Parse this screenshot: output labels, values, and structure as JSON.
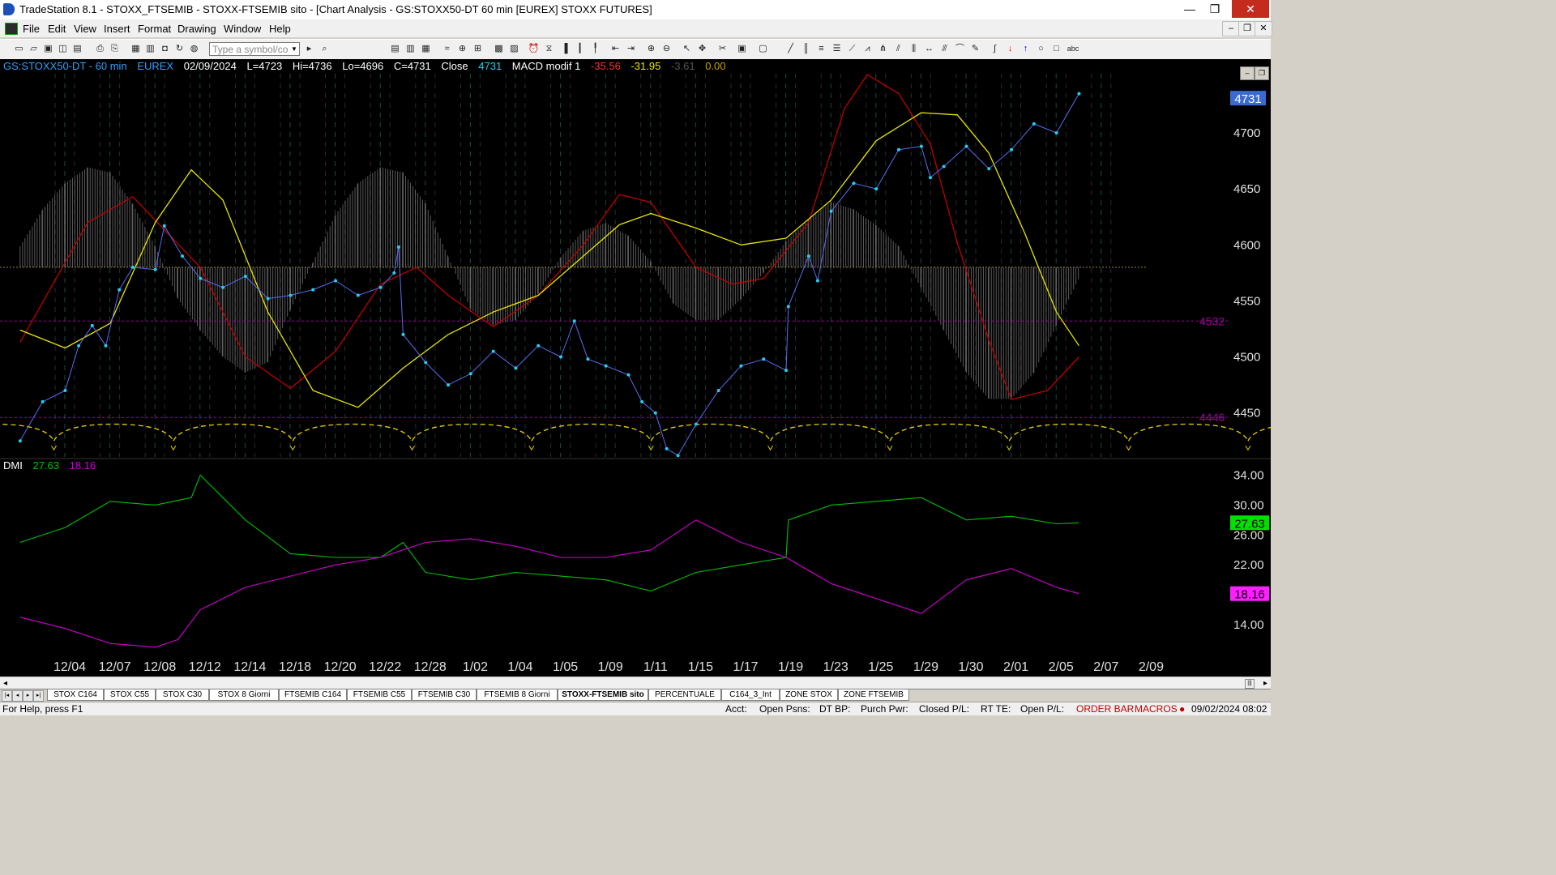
{
  "window": {
    "title": "TradeStation 8.1 - STOXX_FTSEMIB - STOXX-FTSEMIB sito - [Chart Analysis - GS:STOXX50-DT  60 min  [EUREX] STOXX FUTURES]",
    "minimize": "—",
    "maximize": "❐",
    "close": "✕"
  },
  "menu": {
    "items": [
      "File",
      "Edit",
      "View",
      "Insert",
      "Format",
      "Drawing",
      "Window",
      "Help"
    ],
    "mdi_min": "–",
    "mdi_restore": "❐",
    "mdi_close": "✕"
  },
  "toolbar": {
    "symbol_placeholder": "Type a symbol/co",
    "dropdown_icon": "▼"
  },
  "chart_header": {
    "symbol": "GS:STOXX50-DT - 60 min",
    "exchange": "EUREX",
    "date": "02/09/2024",
    "last": "L=4723",
    "high": "Hi=4736",
    "low": "Lo=4696",
    "close_val": "C=4731",
    "close_label": "Close",
    "close_num": "4731",
    "macd_label": "MACD modif 1",
    "macd_v1": "-35.56",
    "macd_v2": "-31.95",
    "macd_v3": "-3.61",
    "macd_v4": "0.00"
  },
  "dmi_header": {
    "label": "DMI",
    "plus": "27.63",
    "minus": "18.16"
  },
  "colors": {
    "price": "#23d0ee",
    "red_ma": "#c00000",
    "yellow_ma": "#e6e600",
    "macd_hist": "#7a7a7a",
    "dmi_plus": "#00c000",
    "dmi_minus": "#d000d0",
    "level": "#a000a0",
    "cycle": "#e6d000"
  },
  "chart_data": [
    {
      "type": "line",
      "title": "GS:STOXX50-DT - 60 min",
      "x_categories": [
        "12/04",
        "12/07",
        "12/08",
        "12/12",
        "12/14",
        "12/18",
        "12/20",
        "12/22",
        "12/28",
        "1/02",
        "1/04",
        "1/05",
        "1/09",
        "1/11",
        "1/15",
        "1/17",
        "1/19",
        "1/23",
        "1/25",
        "1/29",
        "1/30",
        "2/01",
        "2/05",
        "2/07",
        "2/09"
      ],
      "ylim": [
        4410,
        4760
      ],
      "y_ticks": [
        "4700",
        "4650",
        "4600",
        "4550",
        "4500",
        "4450"
      ],
      "last_price_label": "4731",
      "levels": [
        {
          "label": "4532",
          "value": 4532
        },
        {
          "label": "4446",
          "value": 4446
        }
      ],
      "series": [
        {
          "kind": "price",
          "values": [
            {
              "x": 0,
              "y": 4425
            },
            {
              "x": 0.5,
              "y": 4460
            },
            {
              "x": 1,
              "y": 4470
            },
            {
              "x": 1.3,
              "y": 4510
            },
            {
              "x": 1.6,
              "y": 4528
            },
            {
              "x": 1.9,
              "y": 4510
            },
            {
              "x": 2.2,
              "y": 4560
            },
            {
              "x": 2.5,
              "y": 4580
            },
            {
              "x": 3,
              "y": 4578
            },
            {
              "x": 3.2,
              "y": 4617
            },
            {
              "x": 3.6,
              "y": 4590
            },
            {
              "x": 4,
              "y": 4570
            },
            {
              "x": 4.5,
              "y": 4562
            },
            {
              "x": 5,
              "y": 4572
            },
            {
              "x": 5.5,
              "y": 4552
            },
            {
              "x": 6,
              "y": 4555
            },
            {
              "x": 6.5,
              "y": 4560
            },
            {
              "x": 7,
              "y": 4568
            },
            {
              "x": 7.5,
              "y": 4555
            },
            {
              "x": 8,
              "y": 4562
            },
            {
              "x": 8.3,
              "y": 4575
            },
            {
              "x": 8.4,
              "y": 4598
            },
            {
              "x": 8.5,
              "y": 4520
            },
            {
              "x": 9,
              "y": 4495
            },
            {
              "x": 9.5,
              "y": 4475
            },
            {
              "x": 10,
              "y": 4485
            },
            {
              "x": 10.5,
              "y": 4505
            },
            {
              "x": 11,
              "y": 4490
            },
            {
              "x": 11.5,
              "y": 4510
            },
            {
              "x": 12,
              "y": 4500
            },
            {
              "x": 12.3,
              "y": 4532
            },
            {
              "x": 12.6,
              "y": 4498
            },
            {
              "x": 13,
              "y": 4492
            },
            {
              "x": 13.5,
              "y": 4484
            },
            {
              "x": 13.8,
              "y": 4460
            },
            {
              "x": 14.1,
              "y": 4450
            },
            {
              "x": 14.35,
              "y": 4418
            },
            {
              "x": 14.6,
              "y": 4412
            },
            {
              "x": 15,
              "y": 4440
            },
            {
              "x": 15.5,
              "y": 4470
            },
            {
              "x": 16,
              "y": 4492
            },
            {
              "x": 16.5,
              "y": 4498
            },
            {
              "x": 17,
              "y": 4488
            },
            {
              "x": 17.05,
              "y": 4545
            },
            {
              "x": 17.5,
              "y": 4590
            },
            {
              "x": 17.7,
              "y": 4568
            },
            {
              "x": 18,
              "y": 4630
            },
            {
              "x": 18.5,
              "y": 4655
            },
            {
              "x": 19,
              "y": 4650
            },
            {
              "x": 19.5,
              "y": 4685
            },
            {
              "x": 20,
              "y": 4688
            },
            {
              "x": 20.2,
              "y": 4660
            },
            {
              "x": 20.5,
              "y": 4670
            },
            {
              "x": 21,
              "y": 4688
            },
            {
              "x": 21.5,
              "y": 4668
            },
            {
              "x": 22,
              "y": 4685
            },
            {
              "x": 22.5,
              "y": 4708
            },
            {
              "x": 23,
              "y": 4700
            },
            {
              "x": 23.5,
              "y": 4735
            }
          ]
        },
        {
          "kind": "ma_red",
          "values": [
            {
              "x": 0,
              "y": 4513
            },
            {
              "x": 1.5,
              "y": 4620
            },
            {
              "x": 2.5,
              "y": 4643
            },
            {
              "x": 4,
              "y": 4580
            },
            {
              "x": 5,
              "y": 4500
            },
            {
              "x": 6,
              "y": 4472
            },
            {
              "x": 7,
              "y": 4505
            },
            {
              "x": 8,
              "y": 4565
            },
            {
              "x": 8.8,
              "y": 4580
            },
            {
              "x": 9.5,
              "y": 4555
            },
            {
              "x": 10.5,
              "y": 4527
            },
            {
              "x": 11.5,
              "y": 4555
            },
            {
              "x": 12.5,
              "y": 4600
            },
            {
              "x": 13.3,
              "y": 4645
            },
            {
              "x": 14,
              "y": 4638
            },
            {
              "x": 15,
              "y": 4580
            },
            {
              "x": 15.8,
              "y": 4565
            },
            {
              "x": 16.5,
              "y": 4570
            },
            {
              "x": 17.5,
              "y": 4620
            },
            {
              "x": 18.3,
              "y": 4722
            },
            {
              "x": 18.8,
              "y": 4752
            },
            {
              "x": 19.5,
              "y": 4735
            },
            {
              "x": 20.2,
              "y": 4690
            },
            {
              "x": 20.8,
              "y": 4602
            },
            {
              "x": 21.5,
              "y": 4515
            },
            {
              "x": 22,
              "y": 4462
            },
            {
              "x": 22.8,
              "y": 4470
            },
            {
              "x": 23.5,
              "y": 4500
            }
          ]
        },
        {
          "kind": "ma_yellow",
          "values": [
            {
              "x": 0,
              "y": 4524
            },
            {
              "x": 1,
              "y": 4508
            },
            {
              "x": 2,
              "y": 4530
            },
            {
              "x": 3,
              "y": 4620
            },
            {
              "x": 3.8,
              "y": 4667
            },
            {
              "x": 4.5,
              "y": 4640
            },
            {
              "x": 5.5,
              "y": 4540
            },
            {
              "x": 6.5,
              "y": 4470
            },
            {
              "x": 7.5,
              "y": 4455
            },
            {
              "x": 8.5,
              "y": 4490
            },
            {
              "x": 9.5,
              "y": 4520
            },
            {
              "x": 10.5,
              "y": 4540
            },
            {
              "x": 11.5,
              "y": 4555
            },
            {
              "x": 12.5,
              "y": 4590
            },
            {
              "x": 13.3,
              "y": 4618
            },
            {
              "x": 14,
              "y": 4628
            },
            {
              "x": 15,
              "y": 4615
            },
            {
              "x": 16,
              "y": 4600
            },
            {
              "x": 17,
              "y": 4606
            },
            {
              "x": 18,
              "y": 4640
            },
            {
              "x": 19,
              "y": 4693
            },
            {
              "x": 20,
              "y": 4718
            },
            {
              "x": 20.8,
              "y": 4716
            },
            {
              "x": 21.5,
              "y": 4682
            },
            {
              "x": 22.3,
              "y": 4610
            },
            {
              "x": 23,
              "y": 4540
            },
            {
              "x": 23.5,
              "y": 4510
            }
          ]
        }
      ],
      "macd_histogram": [
        {
          "x": 0,
          "h": 0.2
        },
        {
          "x": 0.5,
          "h": 0.55
        },
        {
          "x": 1,
          "h": 0.8
        },
        {
          "x": 1.5,
          "h": 0.95
        },
        {
          "x": 2,
          "h": 0.9
        },
        {
          "x": 2.5,
          "h": 0.6
        },
        {
          "x": 3,
          "h": 0.2
        },
        {
          "x": 3.5,
          "h": -0.3
        },
        {
          "x": 4,
          "h": -0.6
        },
        {
          "x": 4.5,
          "h": -0.85
        },
        {
          "x": 5,
          "h": -1.0
        },
        {
          "x": 5.5,
          "h": -0.9
        },
        {
          "x": 6,
          "h": -0.4
        },
        {
          "x": 6.5,
          "h": 0.05
        },
        {
          "x": 7,
          "h": 0.5
        },
        {
          "x": 7.5,
          "h": 0.8
        },
        {
          "x": 8,
          "h": 0.95
        },
        {
          "x": 8.5,
          "h": 0.9
        },
        {
          "x": 9,
          "h": 0.6
        },
        {
          "x": 9.5,
          "h": 0.1
        },
        {
          "x": 10,
          "h": -0.4
        },
        {
          "x": 10.5,
          "h": -0.55
        },
        {
          "x": 11,
          "h": -0.5
        },
        {
          "x": 11.5,
          "h": -0.25
        },
        {
          "x": 12,
          "h": 0.1
        },
        {
          "x": 12.5,
          "h": 0.35
        },
        {
          "x": 13,
          "h": 0.42
        },
        {
          "x": 13.5,
          "h": 0.3
        },
        {
          "x": 14,
          "h": 0.05
        },
        {
          "x": 14.5,
          "h": -0.35
        },
        {
          "x": 15,
          "h": -0.5
        },
        {
          "x": 15.5,
          "h": -0.5
        },
        {
          "x": 16,
          "h": -0.3
        },
        {
          "x": 16.5,
          "h": -0.05
        },
        {
          "x": 17,
          "h": 0.25
        },
        {
          "x": 17.5,
          "h": 0.45
        },
        {
          "x": 18,
          "h": 0.62
        },
        {
          "x": 18.5,
          "h": 0.55
        },
        {
          "x": 19,
          "h": 0.4
        },
        {
          "x": 19.5,
          "h": 0.2
        },
        {
          "x": 20,
          "h": -0.2
        },
        {
          "x": 20.5,
          "h": -0.6
        },
        {
          "x": 21,
          "h": -1.0
        },
        {
          "x": 21.5,
          "h": -1.25
        },
        {
          "x": 22,
          "h": -1.25
        },
        {
          "x": 22.5,
          "h": -1.0
        },
        {
          "x": 23,
          "h": -0.55
        },
        {
          "x": 23.5,
          "h": -0.1
        }
      ]
    },
    {
      "type": "line",
      "title": "DMI",
      "ylim": [
        10,
        36
      ],
      "y_ticks": [
        "34.00",
        "30.00",
        "26.00",
        "22.00",
        "14.00"
      ],
      "last_labels": [
        "27.63",
        "18.16"
      ],
      "series": [
        {
          "name": "27.63",
          "values": [
            {
              "x": 0,
              "y": 25
            },
            {
              "x": 1,
              "y": 27
            },
            {
              "x": 2,
              "y": 30.5
            },
            {
              "x": 3,
              "y": 30
            },
            {
              "x": 3.8,
              "y": 31
            },
            {
              "x": 4,
              "y": 34
            },
            {
              "x": 4.5,
              "y": 31
            },
            {
              "x": 5,
              "y": 28
            },
            {
              "x": 6,
              "y": 23.5
            },
            {
              "x": 7,
              "y": 23
            },
            {
              "x": 8,
              "y": 23
            },
            {
              "x": 8.5,
              "y": 25
            },
            {
              "x": 9,
              "y": 21
            },
            {
              "x": 10,
              "y": 20
            },
            {
              "x": 11,
              "y": 21
            },
            {
              "x": 12,
              "y": 20.5
            },
            {
              "x": 13,
              "y": 20
            },
            {
              "x": 14,
              "y": 18.5
            },
            {
              "x": 15,
              "y": 21
            },
            {
              "x": 16,
              "y": 22
            },
            {
              "x": 17,
              "y": 23
            },
            {
              "x": 17.05,
              "y": 28
            },
            {
              "x": 18,
              "y": 30
            },
            {
              "x": 19,
              "y": 30.5
            },
            {
              "x": 20,
              "y": 31
            },
            {
              "x": 21,
              "y": 28
            },
            {
              "x": 22,
              "y": 28.5
            },
            {
              "x": 23,
              "y": 27.5
            },
            {
              "x": 23.5,
              "y": 27.63
            }
          ]
        },
        {
          "name": "18.16",
          "values": [
            {
              "x": 0,
              "y": 15
            },
            {
              "x": 1,
              "y": 13.5
            },
            {
              "x": 2,
              "y": 11.5
            },
            {
              "x": 3,
              "y": 11
            },
            {
              "x": 3.5,
              "y": 12
            },
            {
              "x": 4,
              "y": 16
            },
            {
              "x": 5,
              "y": 19
            },
            {
              "x": 6,
              "y": 20.5
            },
            {
              "x": 7,
              "y": 22
            },
            {
              "x": 8,
              "y": 23
            },
            {
              "x": 9,
              "y": 25
            },
            {
              "x": 10,
              "y": 25.5
            },
            {
              "x": 11,
              "y": 24.5
            },
            {
              "x": 12,
              "y": 23
            },
            {
              "x": 13,
              "y": 23
            },
            {
              "x": 14,
              "y": 24
            },
            {
              "x": 15,
              "y": 28
            },
            {
              "x": 16,
              "y": 25
            },
            {
              "x": 17,
              "y": 23
            },
            {
              "x": 18,
              "y": 19.5
            },
            {
              "x": 19,
              "y": 17.5
            },
            {
              "x": 20,
              "y": 15.5
            },
            {
              "x": 21,
              "y": 20
            },
            {
              "x": 22,
              "y": 21.5
            },
            {
              "x": 23,
              "y": 19
            },
            {
              "x": 23.5,
              "y": 18.16
            }
          ]
        }
      ]
    }
  ],
  "sheet_tabs": [
    "STOX C164",
    "STOX C55",
    "STOX  C30",
    "STOX  8 Giorni",
    "FTSEMIB C164",
    "FTSEMIB C55",
    "FTSEMIB C30",
    "FTSEMIB  8 Giorni",
    "STOXX-FTSEMIB sito",
    "PERCENTUALE",
    "C164_3_Int",
    "ZONE STOX",
    "ZONE FTSEMIB"
  ],
  "status": {
    "help": "For Help, press F1",
    "acct": "Acct:",
    "open_psns": "Open Psns:",
    "dt_bp": "DT BP:",
    "purch_pwr": "Purch Pwr:",
    "closed_pl": "Closed P/L:",
    "rt_te": "RT TE:",
    "open_pl": "Open P/L:",
    "order_bar": "ORDER BAR",
    "macros": "MACROS",
    "datetime": "09/02/2024 08:02"
  }
}
